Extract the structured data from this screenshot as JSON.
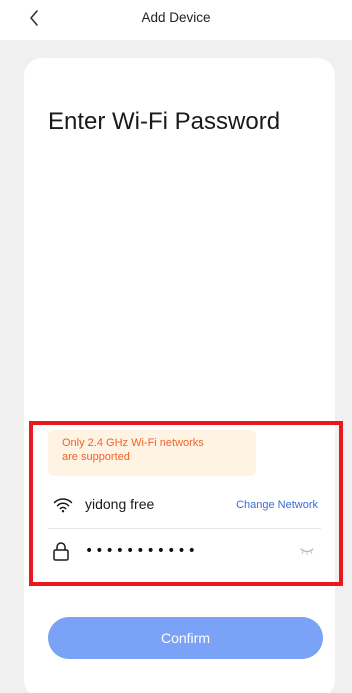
{
  "header": {
    "title": "Add Device",
    "back_icon": "chevron-left-icon"
  },
  "main": {
    "headline": "Enter Wi-Fi Password",
    "notice": {
      "line1": "Only 2.4 GHz Wi-Fi networks",
      "line2": "are supported"
    },
    "network": {
      "icon": "wifi-icon",
      "ssid": "yidong free",
      "change_label": "Change Network"
    },
    "password": {
      "icon": "lock-icon",
      "value": "•••••••••••",
      "visibility_icon": "eye-closed-icon"
    },
    "confirm_label": "Confirm"
  },
  "colors": {
    "accent": "#7aa2f6",
    "link": "#3b6bd6",
    "warning_text": "#f0622a",
    "warning_bg": "#fff4e3",
    "highlight": "#e8181c"
  }
}
